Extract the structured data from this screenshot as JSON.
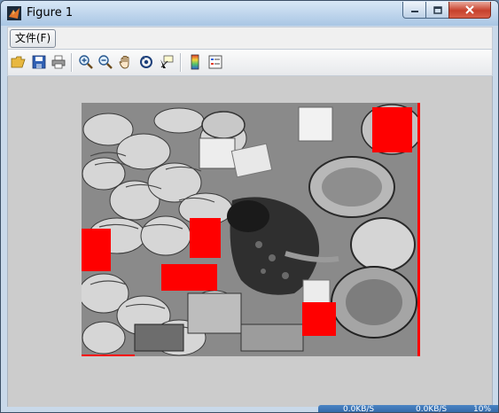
{
  "window": {
    "title": "Figure 1"
  },
  "menu": {
    "items": [
      {
        "label": "文件(F)"
      }
    ]
  },
  "toolbar": {
    "buttons": [
      {
        "name": "open-icon"
      },
      {
        "name": "save-icon"
      },
      {
        "name": "print-icon"
      },
      {
        "name": "zoom-in-icon"
      },
      {
        "name": "zoom-out-icon"
      },
      {
        "name": "pan-hand-icon"
      },
      {
        "name": "rotate-3d-icon"
      },
      {
        "name": "data-cursor-icon"
      },
      {
        "name": "colorbar-icon"
      },
      {
        "name": "legend-icon"
      }
    ]
  },
  "figure": {
    "image": {
      "description_color_mode": "grayscale",
      "marker_color": "#ff0000"
    }
  },
  "status": {
    "left": "0.0KB/S",
    "mid": "0.0KB/S",
    "right": "10%"
  }
}
